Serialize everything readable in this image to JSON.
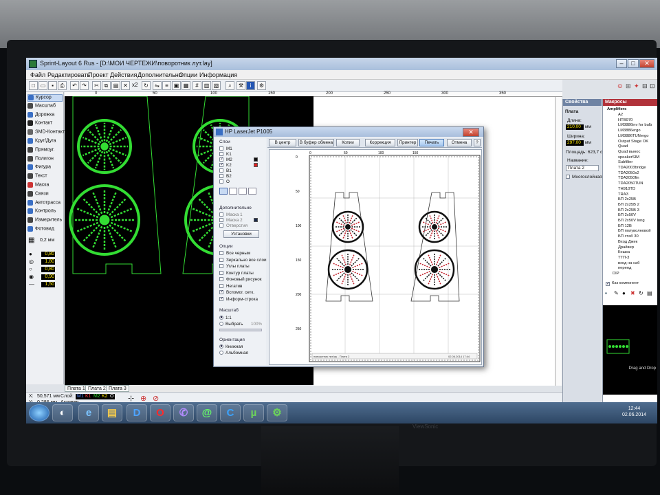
{
  "window": {
    "title": "Sprint-Layout 6 Rus - [D:\\МОИ ЧЕРТЕЖИ\\поворотник лут.lay]",
    "controls": [
      "–",
      "□",
      "✕"
    ]
  },
  "menu": {
    "items": [
      "Файл",
      "Редактировать",
      "Проект",
      "Действия",
      "Дополнительно",
      "Опции",
      "Информация"
    ]
  },
  "toolbar": {
    "zoom": "x2",
    "icons": [
      "new-icon",
      "open-icon",
      "save-icon",
      "print-icon",
      "undo-icon",
      "redo-icon",
      "cut-icon",
      "copy-icon",
      "paste-icon",
      "delete-icon",
      "duplicate-icon",
      "rotate-icon",
      "mirror-icon",
      "align-icon",
      "group-icon",
      "ungroup-icon",
      "zoom-icon",
      "properties-icon",
      "info-icon",
      "settings-icon"
    ]
  },
  "left_tools": [
    {
      "label": "Курсор",
      "icon": "cursor-icon",
      "color": "#3a6fc4",
      "active": true
    },
    {
      "label": "Масштаб",
      "icon": "zoom-icon",
      "color": "#4a4a4a"
    },
    {
      "label": "Дорожка",
      "icon": "track-icon",
      "color": "#3a6fc4"
    },
    {
      "label": "Контакт",
      "icon": "pad-icon",
      "color": "#222"
    },
    {
      "label": "SMD-Контакт",
      "icon": "smd-pad-icon",
      "color": "#666"
    },
    {
      "label": "Круг/Дуга",
      "icon": "circle-icon",
      "color": "#3a6fc4"
    },
    {
      "label": "Прямоуг.",
      "icon": "rectangle-icon",
      "color": "#444"
    },
    {
      "label": "Полигон",
      "icon": "polygon-icon",
      "color": "#444"
    },
    {
      "label": "Фигура",
      "icon": "shape-icon",
      "color": "#3a6fc4"
    },
    {
      "label": "Текст",
      "icon": "text-icon",
      "color": "#444"
    },
    {
      "label": "Маска",
      "icon": "mask-icon",
      "color": "#c33"
    },
    {
      "label": "Связи",
      "icon": "connections-icon",
      "color": "#444"
    },
    {
      "label": "Автотрасса",
      "icon": "autoroute-icon",
      "color": "#3a6fc4"
    },
    {
      "label": "Контроль",
      "icon": "check-icon",
      "color": "#3a6fc4"
    },
    {
      "label": "Измеритель",
      "icon": "measure-icon",
      "color": "#444"
    },
    {
      "label": "Фотовид",
      "icon": "photoview-icon",
      "color": "#3a6fc4"
    }
  ],
  "grid": {
    "value": "0,2 мм"
  },
  "line_values": [
    "0,80",
    "1,80",
    "0,80",
    "0,90",
    "1,50"
  ],
  "board_tabs": [
    "Плата 1",
    "Плата 2",
    "Плата 3"
  ],
  "status": {
    "x_label": "X:",
    "x_value": "50,571 мм",
    "y_label": "Y:",
    "y_value": "0,286 мм",
    "layer_label": "Слой:",
    "active_label": "Активен",
    "layers": [
      {
        "name": "M1",
        "color": "#5a8cff"
      },
      {
        "name": "K1",
        "color": "#ff4040"
      },
      {
        "name": "M2",
        "color": "#33dd33"
      },
      {
        "name": "K2",
        "color": "#ffea00"
      },
      {
        "name": "O",
        "color": "#ffffff"
      }
    ]
  },
  "properties": {
    "header": "Свойства",
    "section": "Плата",
    "length_label": "Длина:",
    "length_value": "210,00",
    "width_label": "Ширина:",
    "width_value": "297,00",
    "unit": "мм",
    "area_label": "Площадь: 623,7 см2",
    "name_label": "Название:",
    "name_value": "Плата 2",
    "multilayer_label": "Многослойная"
  },
  "macros": {
    "header": "Макросы",
    "root": "Amplifiers",
    "items": [
      "A2",
      "HTB970",
      "LM3886inv for bulb",
      "LM3886ergo",
      "LM3886TUNergo",
      "Output Stage OK",
      "Quad",
      "Quad вынос",
      "speakerSIM",
      "Subfilter",
      "TDA2003bridge",
      "TDA2050x2",
      "TDA2050fin",
      "TDA2050TUN",
      "TH910TD",
      "TRA3",
      "БП 2x25В",
      "БП 2x25В 2",
      "БП 2x25В 3",
      "БП 2x50V",
      "БП 2x50V long",
      "БП 12В",
      "БП полуволновой",
      "БП стаб 30",
      "Вход Джек",
      "Драйвер",
      "Кошка",
      "ТТП-3",
      "вход на саб",
      "перенд"
    ],
    "footer_item": "DIP",
    "as_component_label": "Как компонент",
    "drag_drop": "Drag and Drop"
  },
  "print_dialog": {
    "title": "HP LaserJet P1005",
    "layers_group": "Слои",
    "layers": [
      {
        "name": "M1",
        "checked": false,
        "color": ""
      },
      {
        "name": "K1",
        "checked": false,
        "color": ""
      },
      {
        "name": "M2",
        "checked": true,
        "color": "#111111"
      },
      {
        "name": "K2",
        "checked": true,
        "color": "#e02020"
      },
      {
        "name": "B1",
        "checked": false,
        "color": ""
      },
      {
        "name": "B2",
        "checked": false,
        "color": ""
      },
      {
        "name": "O",
        "checked": false,
        "color": ""
      }
    ],
    "extra_group": "Дополнительно",
    "extra": [
      {
        "name": "Маска 1",
        "checked": false
      },
      {
        "name": "Маска 2",
        "checked": false
      },
      {
        "name": "Отверстия",
        "checked": false
      }
    ],
    "set_button": "Установки",
    "options_group": "Опции",
    "options": [
      {
        "name": "Все черным",
        "checked": false
      },
      {
        "name": "Зеркально все слои",
        "checked": false
      },
      {
        "name": "Углы платы",
        "checked": false
      },
      {
        "name": "Контур платы",
        "checked": false
      },
      {
        "name": "Фоновый рисунок",
        "checked": false
      },
      {
        "name": "Негатив",
        "checked": false
      },
      {
        "name": "Вспомог. сетк.",
        "checked": true
      },
      {
        "name": "Информ-строка",
        "checked": true
      }
    ],
    "scale_group": "Масштаб",
    "scale_1": "1:1",
    "scale_select": "Выбрать",
    "scale_percent": "100%",
    "orientation_group": "Ориентация",
    "portrait": "Книжная",
    "landscape": "Альбомная",
    "buttons": {
      "center": "В центр",
      "clipboard": "В буфер обмена",
      "copies": "Копии",
      "correction": "Коррекция",
      "printer": "Принтер",
      "print": "Печать",
      "cancel": "Отмена"
    },
    "help": "?",
    "ruler_h": [
      "0",
      "50",
      "100",
      "150"
    ],
    "ruler_v": [
      "0",
      "50",
      "100",
      "150",
      "200",
      "250"
    ],
    "info_line_left": "поворотник лут.lay - Плата 2",
    "info_line_right": "02.06.2014 17:44"
  },
  "main_ruler": [
    "0",
    "50",
    "100",
    "150",
    "200",
    "250",
    "300",
    "350"
  ],
  "taskbar": {
    "apps": [
      "start-orb-icon",
      "steam-like-icon",
      "ie-icon",
      "explorer-icon",
      "d-app-icon",
      "opera-icon",
      "viber-icon",
      "mail-agent-icon",
      "chrome-like-icon",
      "utorrent-icon",
      "sprint-layout-icon"
    ],
    "time": "12:44",
    "date": "02.06.2014"
  },
  "brand": "ViewSonic"
}
